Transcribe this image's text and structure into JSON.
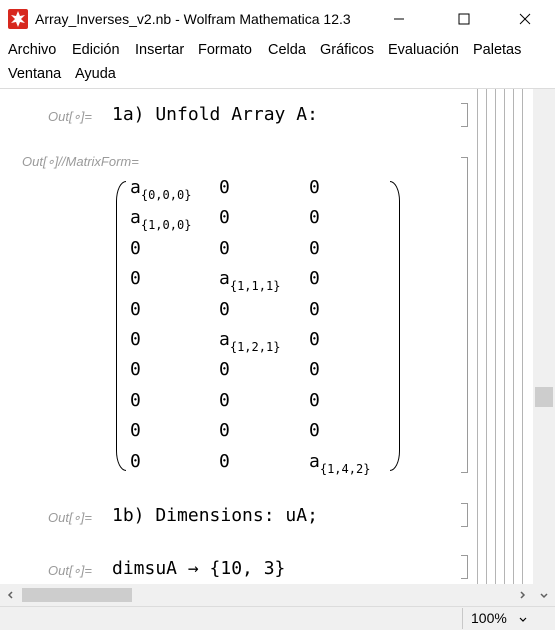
{
  "window": {
    "title": "Array_Inverses_v2.nb - Wolfram Mathematica 12.3",
    "icon": "wolfram-mathematica-icon"
  },
  "menu": [
    {
      "label": "Archivo"
    },
    {
      "label": "Edición"
    },
    {
      "label": "Insertar"
    },
    {
      "label": "Formato"
    },
    {
      "label": "Celda"
    },
    {
      "label": "Gráficos"
    },
    {
      "label": "Evaluación"
    },
    {
      "label": "Paletas"
    },
    {
      "label": "Ventana"
    },
    {
      "label": "Ayuda"
    }
  ],
  "cells": [
    {
      "label": "Out[∘]=",
      "text": "1a) Unfold Array A:"
    },
    {
      "label": "Out[∘]//MatrixForm=",
      "text": ""
    },
    {
      "label": "Out[∘]=",
      "text": "1b) Dimensions: uA;"
    },
    {
      "label": "Out[∘]=",
      "text": "dimsuA → {10, 3}"
    }
  ],
  "matrix": {
    "rows": [
      [
        {
          "base": "a",
          "sub": "{0,0,0}"
        },
        {
          "base": "0",
          "sub": ""
        },
        {
          "base": "0",
          "sub": ""
        }
      ],
      [
        {
          "base": "a",
          "sub": "{1,0,0}"
        },
        {
          "base": "0",
          "sub": ""
        },
        {
          "base": "0",
          "sub": ""
        }
      ],
      [
        {
          "base": "0",
          "sub": ""
        },
        {
          "base": "0",
          "sub": ""
        },
        {
          "base": "0",
          "sub": ""
        }
      ],
      [
        {
          "base": "0",
          "sub": ""
        },
        {
          "base": "a",
          "sub": "{1,1,1}"
        },
        {
          "base": "0",
          "sub": ""
        }
      ],
      [
        {
          "base": "0",
          "sub": ""
        },
        {
          "base": "0",
          "sub": ""
        },
        {
          "base": "0",
          "sub": ""
        }
      ],
      [
        {
          "base": "0",
          "sub": ""
        },
        {
          "base": "a",
          "sub": "{1,2,1}"
        },
        {
          "base": "0",
          "sub": ""
        }
      ],
      [
        {
          "base": "0",
          "sub": ""
        },
        {
          "base": "0",
          "sub": ""
        },
        {
          "base": "0",
          "sub": ""
        }
      ],
      [
        {
          "base": "0",
          "sub": ""
        },
        {
          "base": "0",
          "sub": ""
        },
        {
          "base": "0",
          "sub": ""
        }
      ],
      [
        {
          "base": "0",
          "sub": ""
        },
        {
          "base": "0",
          "sub": ""
        },
        {
          "base": "0",
          "sub": ""
        }
      ],
      [
        {
          "base": "0",
          "sub": ""
        },
        {
          "base": "0",
          "sub": ""
        },
        {
          "base": "a",
          "sub": "{1,4,2}"
        }
      ]
    ]
  },
  "status": {
    "zoom": "100%"
  },
  "colors": {
    "label": "#9a9a9a",
    "bracket": "#9a9a9a",
    "scrollbar": "#f0f0f0"
  }
}
